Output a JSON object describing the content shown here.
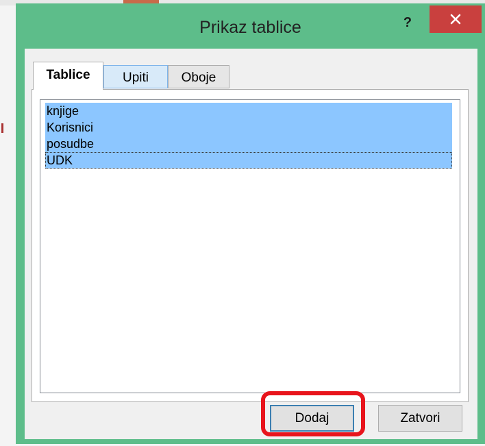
{
  "dialog": {
    "title": "Prikaz tablice",
    "help_label": "?",
    "close_icon": "close-icon"
  },
  "tabs": [
    {
      "label": "Tablice",
      "active": true
    },
    {
      "label": "Upiti",
      "active": false
    },
    {
      "label": "Oboje",
      "active": false
    }
  ],
  "list": {
    "items": [
      {
        "label": "knjige",
        "selected": true
      },
      {
        "label": "Korisnici",
        "selected": true
      },
      {
        "label": "posudbe",
        "selected": true
      },
      {
        "label": "UDK",
        "selected": true,
        "focused": true
      }
    ]
  },
  "buttons": {
    "add_label": "Dodaj",
    "close_label": "Zatvori"
  },
  "colors": {
    "frame": "#5dbd8a",
    "close_button": "#c9403e",
    "selection": "#8cc6ff",
    "highlight_ring": "#e8141c"
  }
}
